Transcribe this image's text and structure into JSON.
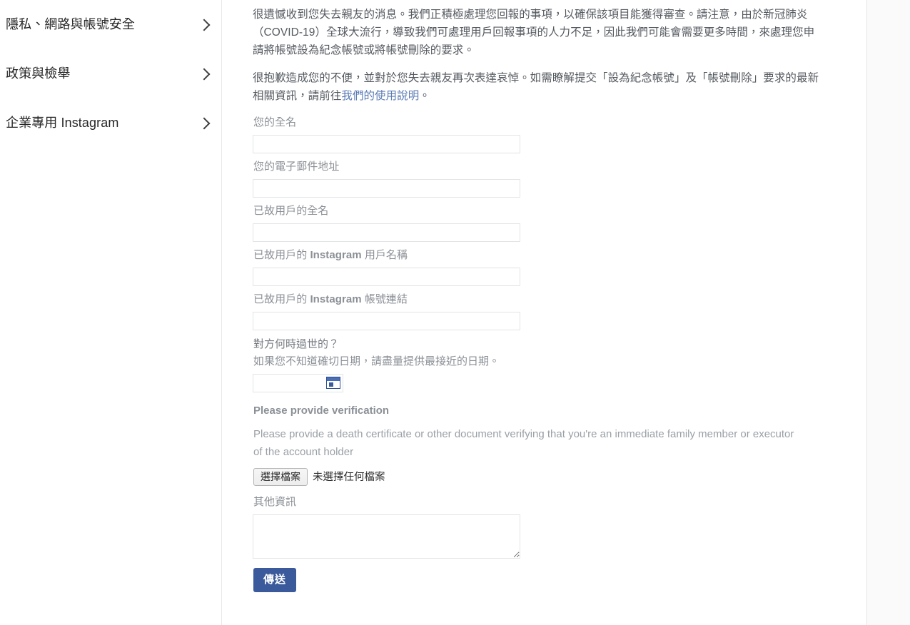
{
  "sidebar": {
    "items": [
      {
        "label": "隱私、網路與帳號安全",
        "icon": "chevron-right-icon"
      },
      {
        "label": "政策與檢舉",
        "icon": "chevron-right-icon"
      },
      {
        "label": "企業專用 Instagram",
        "icon": "chevron-right-icon"
      }
    ]
  },
  "main": {
    "intro_paragraph_1": "很遺憾收到您失去親友的消息。我們正積極處理您回報的事項，以確保該項目能獲得審查。請注意，由於新冠肺炎（COVID-19）全球大流行，導致我們可處理用戶回報事項的人力不足，因此我們可能會需要更多時間，來處理您申請將帳號設為紀念帳號或將帳號刪除的要求。",
    "intro_paragraph_2_before_link": "很抱歉造成您的不便，並對於您失去親友再次表達哀悼。如需瞭解提交「設為紀念帳號」及「帳號刪除」要求的最新相關資訊，請前往",
    "intro_link_text": "我們的使用說明",
    "intro_paragraph_2_after_link": "。",
    "fields": {
      "full_name": {
        "label": "您的全名",
        "value": "",
        "placeholder": ""
      },
      "email": {
        "label": "您的電子郵件地址",
        "value": "",
        "placeholder": ""
      },
      "deceased_full_name": {
        "label": "已故用戶的全名",
        "value": "",
        "placeholder": ""
      },
      "deceased_username": {
        "label_prefix": "已故用戶的 ",
        "label_brand": "Instagram",
        "label_suffix": " 用戶名稱",
        "value": "",
        "placeholder": ""
      },
      "deceased_account_link": {
        "label_prefix": "已故用戶的 ",
        "label_brand": "Instagram",
        "label_suffix": " 帳號連結",
        "value": "",
        "placeholder": ""
      },
      "date_of_death": {
        "label": "對方何時過世的？",
        "hint": "如果您不知道確切日期，請盡量提供最接近的日期。",
        "value": "",
        "picker_icon": "calendar-picker-icon"
      },
      "verification": {
        "title": "Please provide verification",
        "description": "Please provide a death certificate or other document verifying that you're an immediate family member or executor of the account holder",
        "choose_file_label": "選擇檔案",
        "file_status": "未選擇任何檔案"
      },
      "additional_info": {
        "label": "其他資訊",
        "value": "",
        "placeholder": ""
      }
    },
    "submit_label": "傳送"
  },
  "colors": {
    "link": "#5b7bb5",
    "submit_button": "#3b5a9b",
    "label_text": "#8b9096",
    "body_text": "#555a60",
    "border": "#e2e4e6",
    "divider": "#e8e8e8",
    "rail_background": "#fafafa"
  }
}
